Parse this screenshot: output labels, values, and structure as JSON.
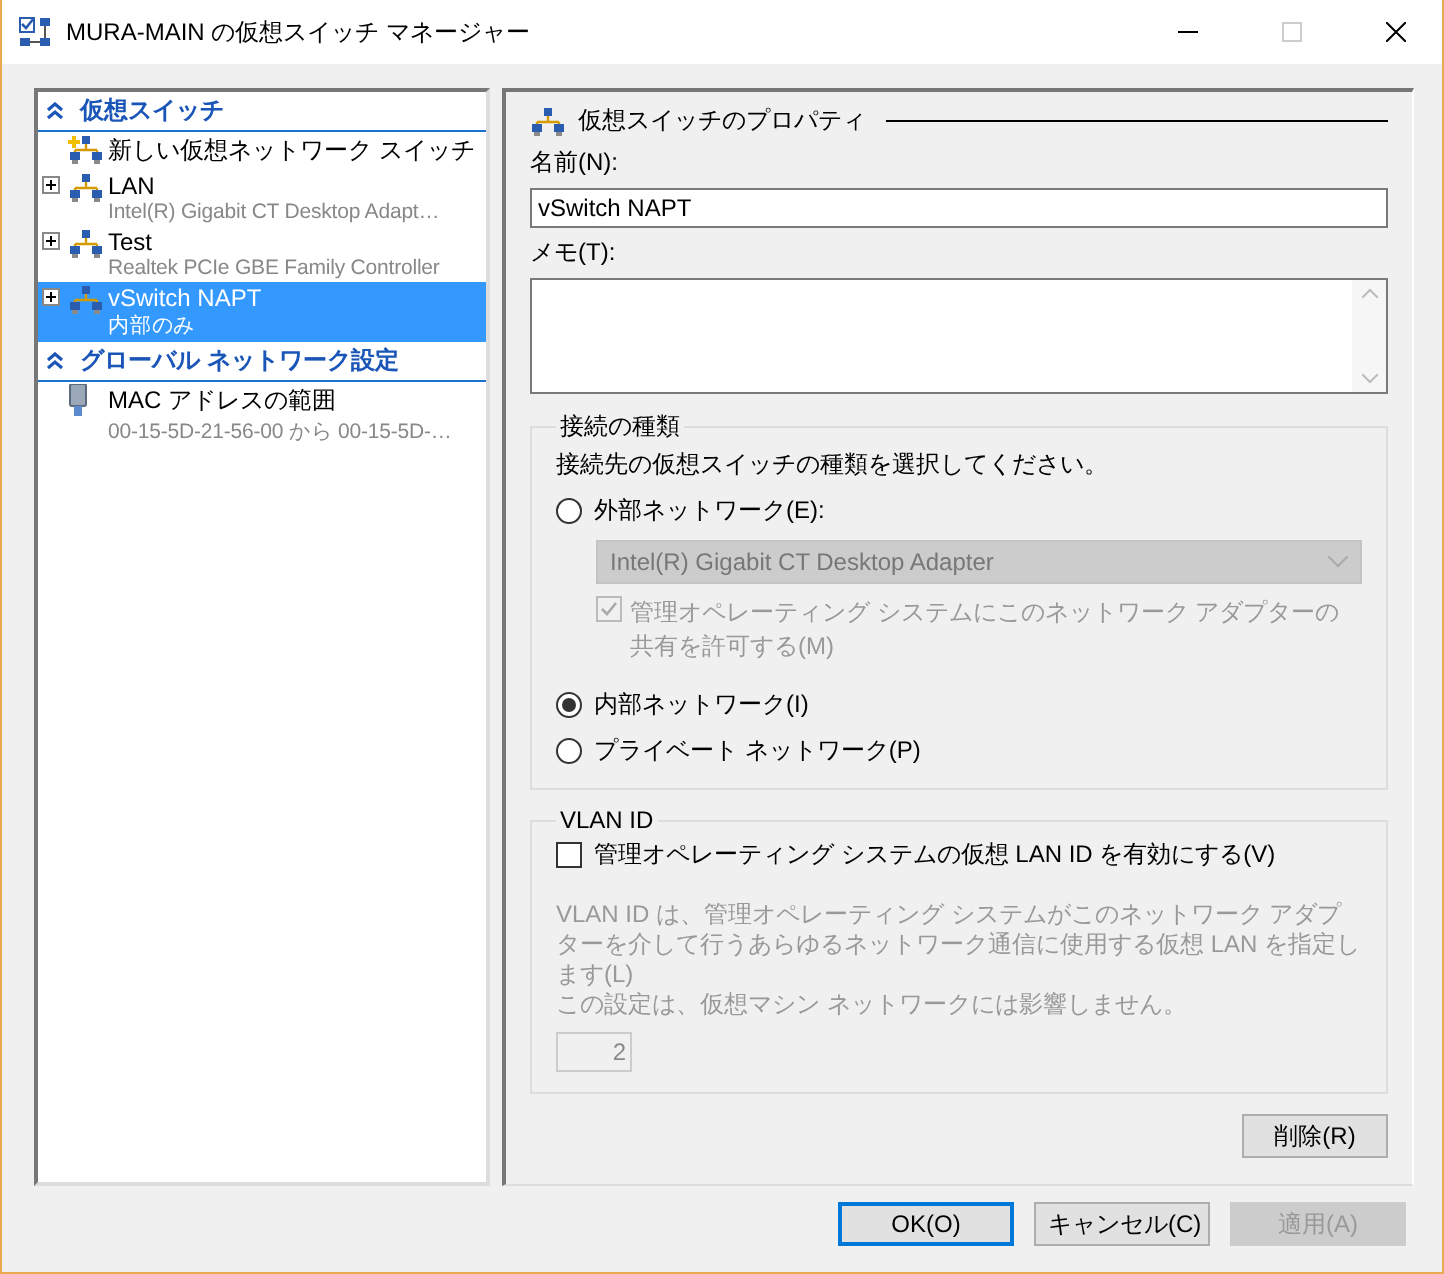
{
  "window": {
    "title": "MURA-MAIN の仮想スイッチ マネージャー",
    "maximize_disabled": true
  },
  "sidebar": {
    "sections": [
      {
        "title": "仮想スイッチ",
        "expanded": true,
        "items": [
          {
            "kind": "new",
            "title": "新しい仮想ネットワーク スイッチ",
            "expandable": false,
            "selected": false
          },
          {
            "kind": "switch",
            "title": "LAN",
            "subtitle": "Intel(R) Gigabit CT Desktop Adapt…",
            "expandable": true,
            "selected": false
          },
          {
            "kind": "switch",
            "title": "Test",
            "subtitle": "Realtek PCIe GBE Family Controller",
            "expandable": true,
            "selected": false
          },
          {
            "kind": "switch",
            "title": "vSwitch NAPT",
            "subtitle": "内部のみ",
            "expandable": true,
            "selected": true
          }
        ]
      },
      {
        "title": "グローバル ネットワーク設定",
        "expanded": true,
        "items": [
          {
            "kind": "mac",
            "title": "MAC アドレスの範囲",
            "subtitle": "00-15-5D-21-56-00 から 00-15-5D-…",
            "expandable": false,
            "selected": false
          }
        ]
      }
    ]
  },
  "properties": {
    "header": "仮想スイッチのプロパティ",
    "name_label": "名前(N):",
    "name_value": "vSwitch NAPT",
    "memo_label": "メモ(T):",
    "connection": {
      "legend": "接続の種類",
      "instruction": "接続先の仮想スイッチの種類を選択してください。",
      "options": [
        {
          "kind": "external",
          "label": "外部ネットワーク(E):",
          "selected": false
        },
        {
          "kind": "internal",
          "label": "内部ネットワーク(I)",
          "selected": true
        },
        {
          "kind": "private",
          "label": "プライベート ネットワーク(P)",
          "selected": false
        }
      ],
      "adapter": {
        "value": "Intel(R) Gigabit CT Desktop Adapter",
        "disabled": true
      },
      "share": {
        "label": "管理オペレーティング システムにこのネットワーク アダプターの共有を許可する(M)",
        "checked": true,
        "disabled": true
      }
    },
    "vlan": {
      "legend": "VLAN ID",
      "checkbox": {
        "label": "管理オペレーティング システムの仮想 LAN ID を有効にする(V)",
        "checked": false
      },
      "description": [
        "VLAN ID は、管理オペレーティング システムがこのネットワーク アダプターを介して行うあらゆるネットワーク通信に使用する仮想 LAN を指定します(L)",
        "この設定は、仮想マシン ネットワークには影響しません。"
      ],
      "value": "2",
      "disabled": true
    },
    "delete_button": "削除(R)"
  },
  "buttons": [
    {
      "label": "OK(O)",
      "default": true,
      "disabled": false
    },
    {
      "label": "キャンセル(C)",
      "default": false,
      "disabled": false
    },
    {
      "label": "適用(A)",
      "default": false,
      "disabled": true
    }
  ]
}
